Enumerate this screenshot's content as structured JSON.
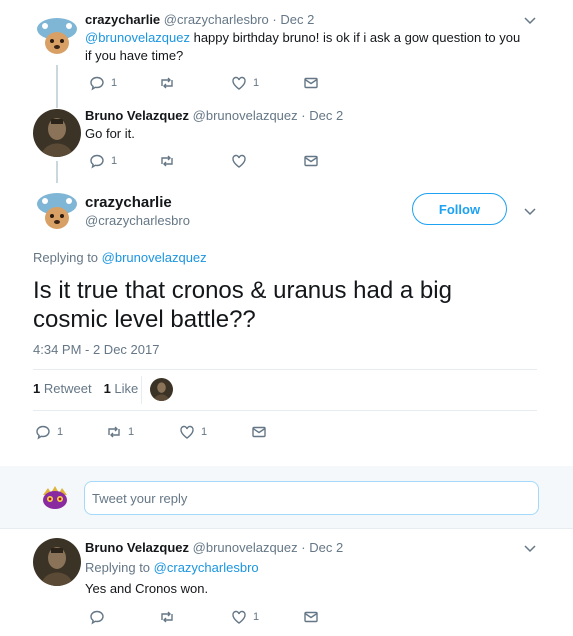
{
  "tweets": [
    {
      "name": "crazycharlie",
      "handle": "@crazycharlesbro",
      "date": "Dec 2",
      "mention": "@brunovelazquez",
      "text": " happy birthday bruno! is ok if i ask a gow question to you if you have time?",
      "reply_count": "1",
      "retweet_count": "",
      "like_count": "1"
    },
    {
      "name": "Bruno Velazquez",
      "handle": "@brunovelazquez",
      "date": "Dec 2",
      "text": "Go for it.",
      "reply_count": "1",
      "retweet_count": "",
      "like_count": ""
    }
  ],
  "focus": {
    "name": "crazycharlie",
    "handle": "@crazycharlesbro",
    "follow_label": "Follow",
    "replying_prefix": "Replying to",
    "replying_to": "@brunovelazquez",
    "text": "Is it true that cronos & uranus had a big cosmic level battle??",
    "timestamp": "4:34 PM - 2 Dec 2017",
    "retweets_count": "1",
    "retweets_label": "Retweet",
    "likes_count": "1",
    "likes_label": "Like",
    "reply_count": "1",
    "retweet_count": "1",
    "like_count": "1"
  },
  "reply_box": {
    "placeholder": "Tweet your reply"
  },
  "reply": {
    "name": "Bruno Velazquez",
    "handle": "@brunovelazquez",
    "date": "Dec 2",
    "replying_prefix": "Replying to",
    "replying_to": "@crazycharlesbro",
    "text": "Yes and Cronos won.",
    "reply_count": "",
    "retweet_count": "",
    "like_count": "1"
  },
  "separator": "·",
  "colors": {
    "link": "#1b95e0",
    "accent": "#1da1f2",
    "muted": "#657786",
    "divider": "#e6ecf0"
  }
}
